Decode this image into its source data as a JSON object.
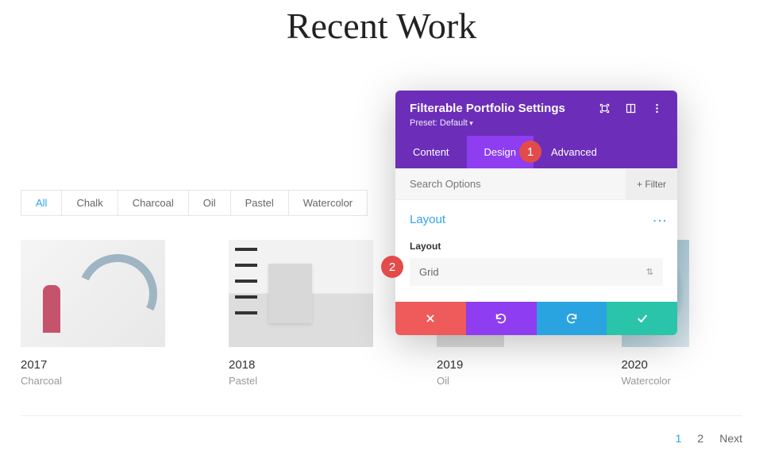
{
  "page": {
    "title": "Recent Work"
  },
  "filters": [
    "All",
    "Chalk",
    "Charcoal",
    "Oil",
    "Pastel",
    "Watercolor"
  ],
  "gallery": [
    {
      "year": "2017",
      "category": "Charcoal"
    },
    {
      "year": "2018",
      "category": "Pastel"
    },
    {
      "year": "2019",
      "category": "Oil"
    },
    {
      "year": "2020",
      "category": "Watercolor"
    }
  ],
  "panel": {
    "title": "Filterable Portfolio Settings",
    "preset": "Preset: Default",
    "tabs": {
      "content": "Content",
      "design": "Design",
      "advanced": "Advanced"
    },
    "search_placeholder": "Search Options",
    "filter_btn": "+ Filter",
    "section_title": "Layout",
    "field_label": "Layout",
    "field_value": "Grid"
  },
  "badges": {
    "one": "1",
    "two": "2"
  },
  "pagination": {
    "p1": "1",
    "p2": "2",
    "next": "Next"
  }
}
